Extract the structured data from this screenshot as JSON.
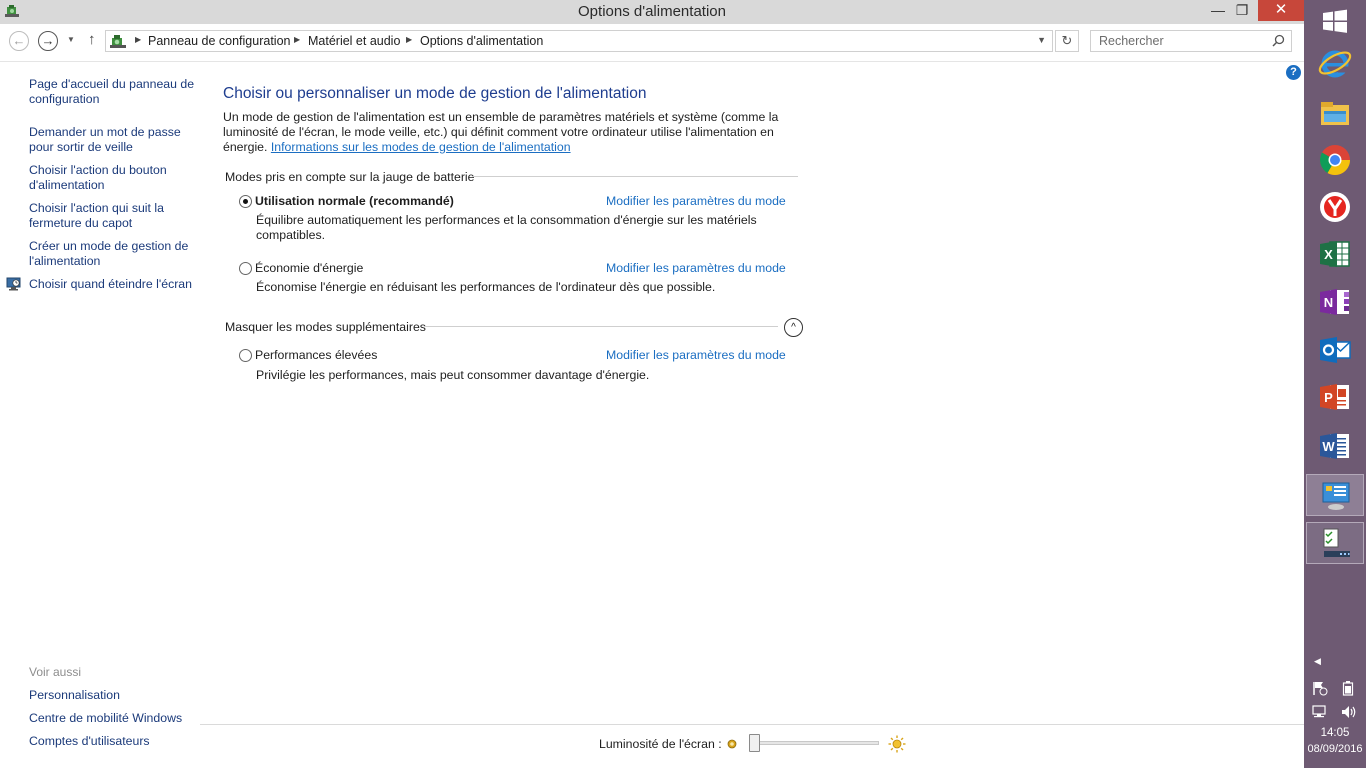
{
  "window": {
    "title": "Options d'alimentation",
    "minimize_glyph": "—",
    "maximize_glyph": "❐",
    "close_glyph": "✕"
  },
  "navbar": {
    "breadcrumbs": [
      "Panneau de configuration",
      "Matériel et audio",
      "Options d'alimentation"
    ],
    "search_placeholder": "Rechercher"
  },
  "help": {
    "label": "?"
  },
  "sidebar": {
    "links": [
      "Page d'accueil du panneau de configuration",
      "Demander un mot de passe pour sortir de veille",
      "Choisir l'action du bouton d'alimentation",
      "Choisir l'action qui suit la fermeture du capot",
      "Créer un mode de gestion de l'alimentation",
      "Choisir quand éteindre l'écran"
    ],
    "see_also_heading": "Voir aussi",
    "see_also": [
      "Personnalisation",
      "Centre de mobilité Windows",
      "Comptes d'utilisateurs"
    ]
  },
  "main": {
    "title": "Choisir ou personnaliser un mode de gestion de l'alimentation",
    "intro": "Un mode de gestion de l'alimentation est un ensemble de paramètres matériels et système (comme la luminosité de l'écran, le mode veille, etc.) qui définit comment votre ordinateur utilise l'alimentation en énergie.",
    "intro_link": "Informations sur les modes de gestion de l'alimentation",
    "group1_heading": "Modes pris en compte sur la jauge de batterie",
    "group2_heading": "Masquer les modes supplémentaires",
    "plans": [
      {
        "name": "Utilisation normale (recommandé)",
        "description": "Équilibre automatiquement les performances et la consommation d'énergie sur les matériels compatibles.",
        "link": "Modifier les paramètres du mode",
        "selected": true
      },
      {
        "name": "Économie d'énergie",
        "description": "Économise l'énergie en réduisant les performances de l'ordinateur dès que possible.",
        "link": "Modifier les paramètres du mode",
        "selected": false
      },
      {
        "name": "Performances élevées",
        "description": "Privilégie les performances, mais peut consommer davantage d'énergie.",
        "link": "Modifier les paramètres du mode",
        "selected": false
      }
    ]
  },
  "brightness": {
    "label": "Luminosité de l'écran :",
    "level_percent": 0
  },
  "taskbar": {
    "apps": [
      "windows-start",
      "internet-explorer",
      "file-explorer",
      "chrome",
      "yandex",
      "excel",
      "onenote",
      "outlook",
      "powerpoint",
      "word",
      "control-panel",
      "task-manager"
    ],
    "time": "14:05",
    "date": "08/09/2016",
    "colors": {
      "background": "#6e5a73"
    }
  },
  "colors": {
    "link": "#1b6ec2",
    "title": "#1e3d8f",
    "sidebar_link": "#1b3a7a",
    "close_button": "#c7473a"
  }
}
